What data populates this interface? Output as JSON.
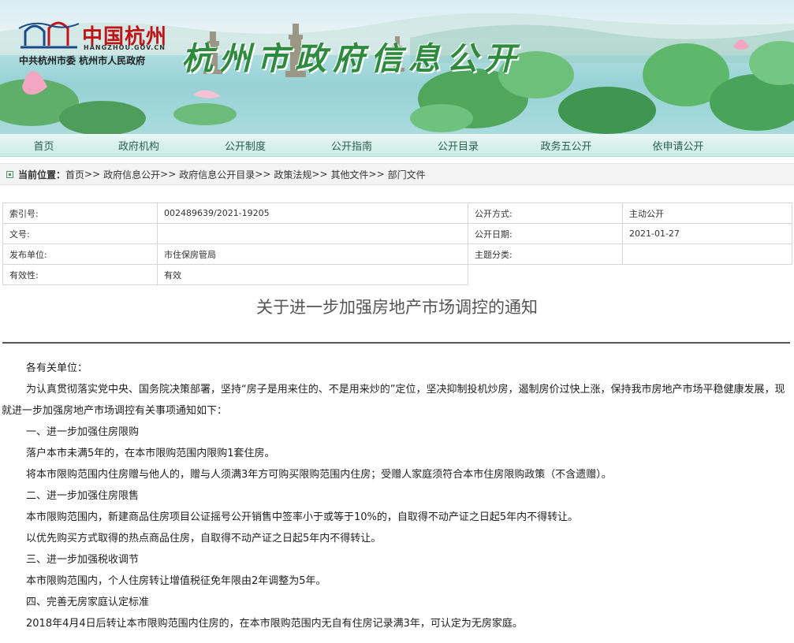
{
  "header": {
    "logo_cn": "中国杭州",
    "logo_domain": "HANGZHOU.GOV.CN",
    "logo_party": "中共杭州市委  杭州市人民政府",
    "site_title": "杭州市政府信息公开",
    "colors": {
      "brand_red": "#c01418",
      "title_green": "#2e8b3e"
    }
  },
  "nav": {
    "items": [
      "首页",
      "政府机构",
      "公开制度",
      "公开指南",
      "公开目录",
      "政务五公开",
      "依申请公开"
    ]
  },
  "breadcrumb": {
    "label": "当前位置：",
    "items": [
      "首页",
      "政府信息公开",
      "政府信息公开目录",
      "政策法规",
      "其他文件",
      "部门文件"
    ],
    "separator": ">>"
  },
  "meta": {
    "index_label": "索引号:",
    "index_value": "002489639/2021-19205",
    "method_label": "公开方式:",
    "method_value": "主动公开",
    "docno_label": "文号:",
    "docno_value": "",
    "date_label": "公开日期:",
    "date_value": "2021-01-27",
    "issuer_label": "发布单位:",
    "issuer_value": "市住保房管局",
    "topic_label": "主题分类:",
    "topic_value": "",
    "validity_label": "有效性:",
    "validity_value": "有效"
  },
  "article": {
    "title": "关于进一步加强房地产市场调控的通知",
    "paragraphs": [
      "各有关单位：",
      "为认真贯彻落实党中央、国务院决策部署，坚持“房子是用来住的、不是用来炒的”定位，坚决抑制投机炒房，遏制房价过快上涨，保持我市房地产市场平稳健康发展，现就进一步加强房地产市场调控有关事项通知如下：",
      "一、进一步加强住房限购",
      "落户本市未满5年的，在本市限购范围内限购1套住房。",
      "将本市限购范围内住房赠与他人的，赠与人须满3年方可购买限购范围内住房；受赠人家庭须符合本市住房限购政策（不含遗赠）。",
      "二、进一步加强住房限售",
      "本市限购范围内，新建商品住房项目公证摇号公开销售中签率小于或等于10%的，自取得不动产证之日起5年内不得转让。",
      "以优先购买方式取得的热点商品住房，自取得不动产证之日起5年内不得转让。",
      "三、进一步加强税收调节",
      "本市限购范围内，个人住房转让增值税征免年限由2年调整为5年。",
      "四、完善无房家庭认定标准",
      "2018年4月4日后转让本市限购范围内住房的，在本市限购范围内无自有住房记录满3年，可认定为无房家庭。"
    ]
  }
}
